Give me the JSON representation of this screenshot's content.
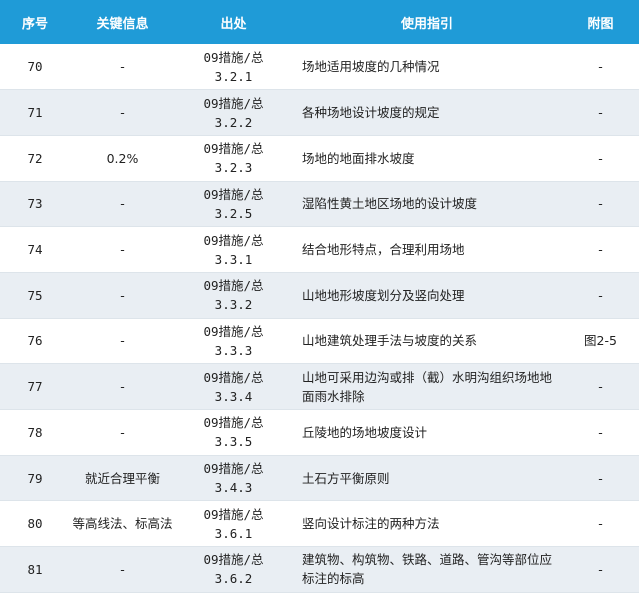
{
  "headers": {
    "no": "序号",
    "key": "关键信息",
    "source": "出处",
    "guide": "使用指引",
    "figure": "附图"
  },
  "rows": [
    {
      "no": "70",
      "key": "-",
      "src1": "09措施/总",
      "src2": "3.2.1",
      "guide": "场地适用坡度的几种情况",
      "figure": "-"
    },
    {
      "no": "71",
      "key": "-",
      "src1": "09措施/总",
      "src2": "3.2.2",
      "guide": "各种场地设计坡度的规定",
      "figure": "-"
    },
    {
      "no": "72",
      "key": "0.2%",
      "src1": "09措施/总",
      "src2": "3.2.3",
      "guide": "场地的地面排水坡度",
      "figure": "-"
    },
    {
      "no": "73",
      "key": "-",
      "src1": "09措施/总",
      "src2": "3.2.5",
      "guide": "湿陷性黄土地区场地的设计坡度",
      "figure": "-"
    },
    {
      "no": "74",
      "key": "-",
      "src1": "09措施/总",
      "src2": "3.3.1",
      "guide": "结合地形特点，合理利用场地",
      "figure": "-"
    },
    {
      "no": "75",
      "key": "-",
      "src1": "09措施/总",
      "src2": "3.3.2",
      "guide": "山地地形坡度划分及竖向处理",
      "figure": "-"
    },
    {
      "no": "76",
      "key": "-",
      "src1": "09措施/总",
      "src2": "3.3.3",
      "guide": "山地建筑处理手法与坡度的关系",
      "figure": "图2-5"
    },
    {
      "no": "77",
      "key": "-",
      "src1": "09措施/总",
      "src2": "3.3.4",
      "guide": "山地可采用边沟或排（截）水明沟组织场地地面雨水排除",
      "figure": "-"
    },
    {
      "no": "78",
      "key": "-",
      "src1": "09措施/总",
      "src2": "3.3.5",
      "guide": "丘陵地的场地坡度设计",
      "figure": "-"
    },
    {
      "no": "79",
      "key": "就近合理平衡",
      "src1": "09措施/总",
      "src2": "3.4.3",
      "guide": "土石方平衡原则",
      "figure": "-"
    },
    {
      "no": "80",
      "key": "等高线法、标高法",
      "src1": "09措施/总",
      "src2": "3.6.1",
      "guide": "竖向设计标注的两种方法",
      "figure": "-"
    },
    {
      "no": "81",
      "key": "-",
      "src1": "09措施/总",
      "src2": "3.6.2",
      "guide": "建筑物、构筑物、铁路、道路、管沟等部位应标注的标高",
      "figure": "-"
    }
  ]
}
